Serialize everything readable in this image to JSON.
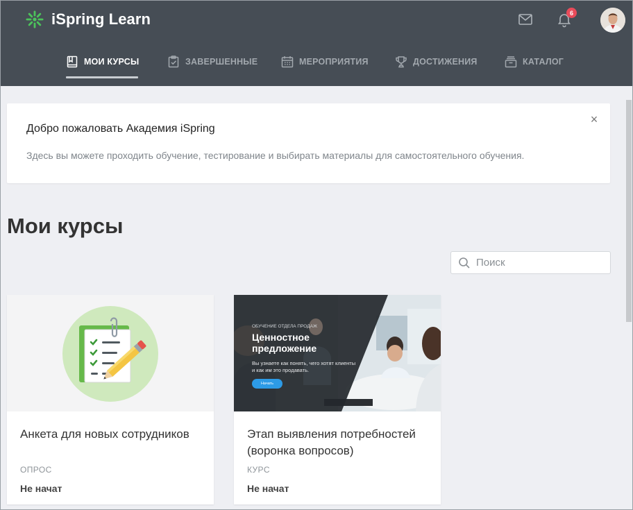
{
  "app": {
    "name": "iSpring Learn",
    "notifications_count": "6",
    "colors": {
      "header": "#464d55",
      "accent_green": "#4caf50",
      "badge": "#e94b5a"
    }
  },
  "nav": {
    "items": [
      {
        "label": "МОИ КУРСЫ",
        "icon": "book-icon",
        "active": true
      },
      {
        "label": "ЗАВЕРШЕННЫЕ",
        "icon": "clipboard-check-icon",
        "active": false
      },
      {
        "label": "МЕРОПРИЯТИЯ",
        "icon": "calendar-icon",
        "active": false
      },
      {
        "label": "ДОСТИЖЕНИЯ",
        "icon": "trophy-icon",
        "active": false
      },
      {
        "label": "КАТАЛОГ",
        "icon": "catalog-box-icon",
        "active": false
      }
    ]
  },
  "welcome": {
    "title": "Добро пожаловать Академия iSpring",
    "text": "Здесь вы можете проходить обучение, тестирование и выбирать материалы для самостоятельного обучения.",
    "close_label": "×"
  },
  "page": {
    "title": "Мои курсы"
  },
  "search": {
    "placeholder": "Поиск",
    "value": ""
  },
  "courses": [
    {
      "title": "Анкета для новых сотрудников",
      "type": "ОПРОС",
      "status": "Не начат",
      "thumb_icon": "survey-clipboard-icon"
    },
    {
      "title": "Этап выявления потребностей (воронка вопросов)",
      "type": "КУРС",
      "status": "Не начат",
      "thumb": {
        "kicker": "ОБУЧЕНИЕ ОТДЕЛА ПРОДАЖ",
        "title_line1": "Ценностное",
        "title_line2": "предложение",
        "desc": "Вы узнаете как понять, чего хотят клиенты и как им это продавать.",
        "button": "Начать"
      }
    }
  ]
}
